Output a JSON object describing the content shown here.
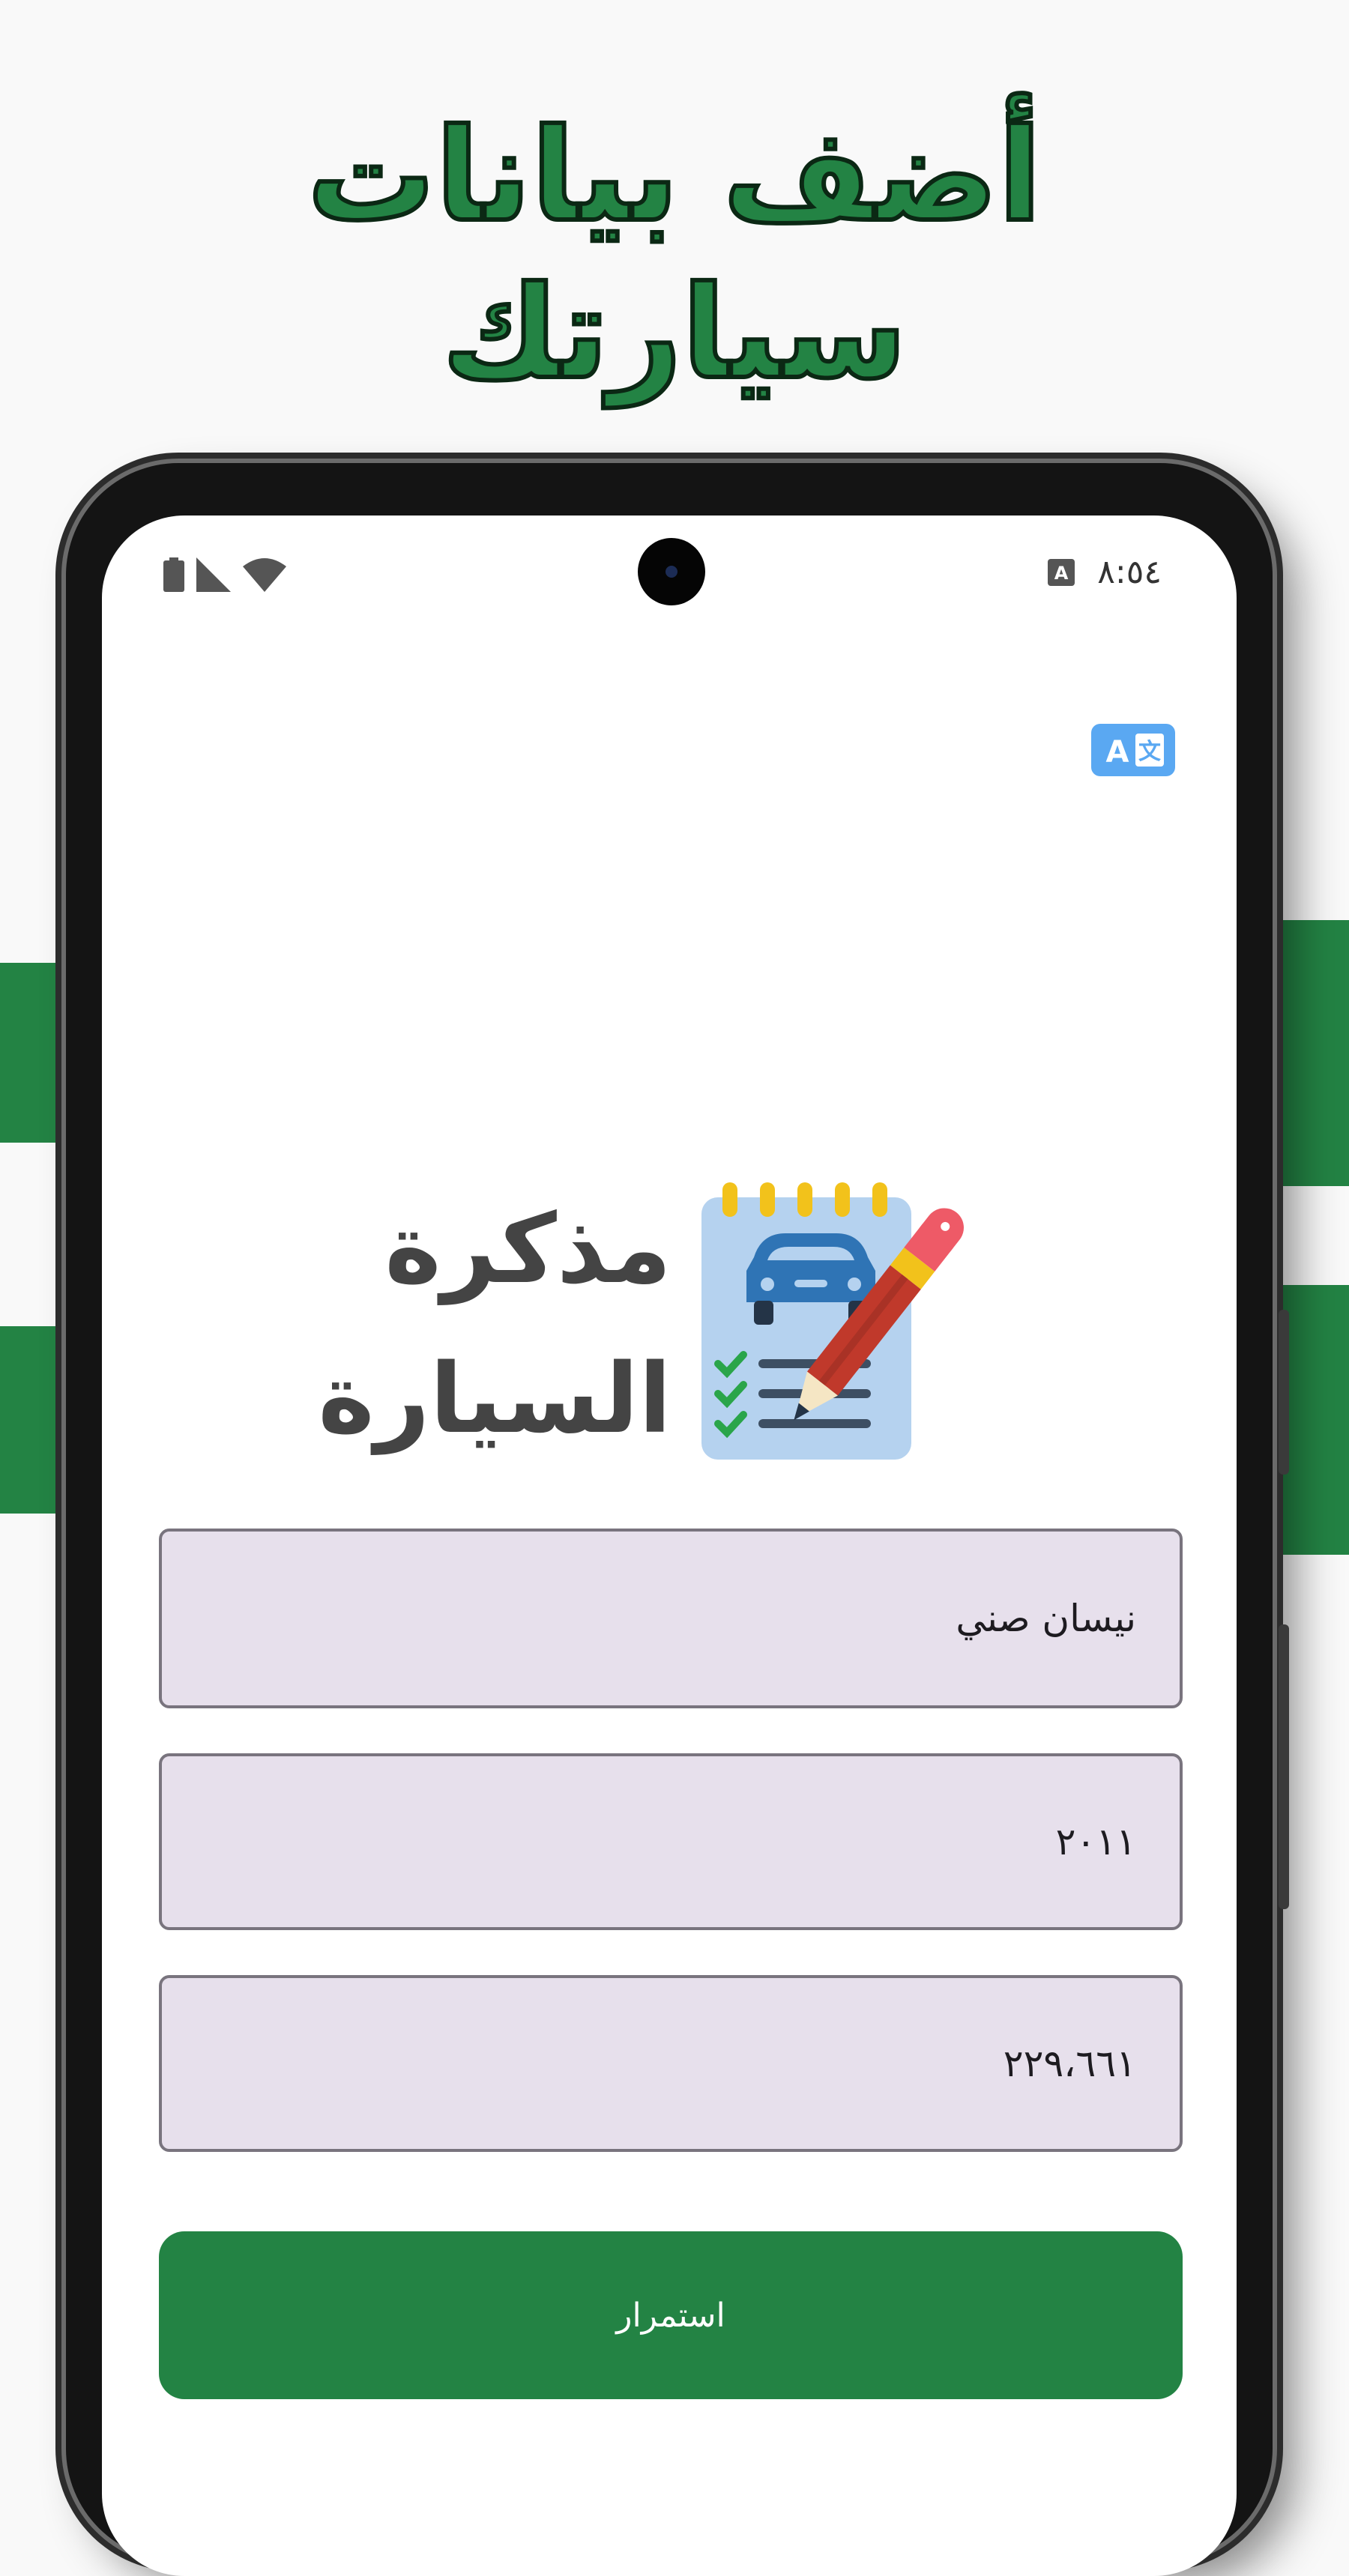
{
  "banner": {
    "line1": "أضف بيانات",
    "line2": "سيارتك"
  },
  "status_bar": {
    "time": "٨:٥٤",
    "icons": [
      "battery-icon",
      "signal-icon",
      "wifi-icon",
      "accessibility-a-icon"
    ]
  },
  "app": {
    "translate_icon": "translate-icon",
    "logo_line1": "مذكرة",
    "logo_line2": "السيارة",
    "logo_icon": "car-notebook-pencil-icon"
  },
  "form": {
    "car_name_value": "نيسان صني",
    "year_value": "٢٠١١",
    "mileage_value": "٢٢٩،٦٦١",
    "continue_label": "استمرار"
  },
  "colors": {
    "accent": "#238344",
    "field_bg": "#e7e0ec",
    "translate_bg": "#5aa8f2"
  }
}
